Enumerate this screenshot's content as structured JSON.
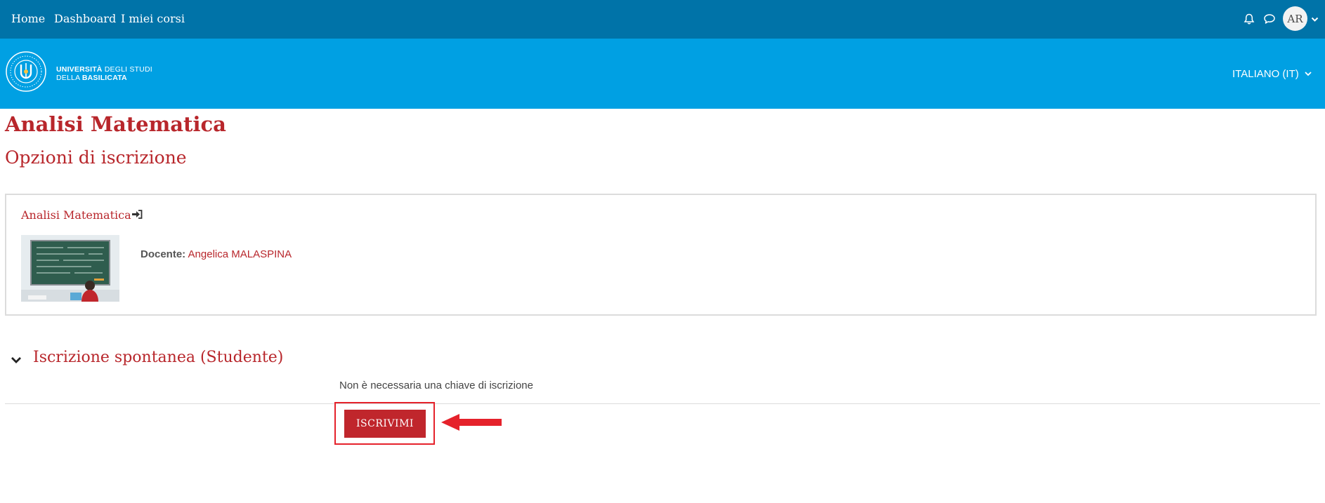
{
  "nav": {
    "links": [
      "Home",
      "Dashboard",
      "I miei corsi"
    ],
    "icons": [
      "bell-icon",
      "chat-icon"
    ],
    "avatar_initials": "AR"
  },
  "banner": {
    "logo_text_line1_bold": "UNIVERSITÀ",
    "logo_text_line1_rest": " DEGLI STUDI",
    "logo_text_line2_rest": "DELLA ",
    "logo_text_line2_bold": "BASILICATA",
    "language": "ITALIANO (IT)"
  },
  "page": {
    "course_title": "Analisi Matematica",
    "subtitle": "Opzioni di iscrizione"
  },
  "course_box": {
    "course_link": "Analisi Matematica",
    "teacher_label": "Docente:",
    "teacher_name": "Angelica MALASPINA"
  },
  "enrolment": {
    "section_title": "Iscrizione spontanea (Studente)",
    "note": "Non è necessaria una chiave di iscrizione",
    "button_label": "ISCRIVIMI"
  },
  "colors": {
    "topbar": "#0073a8",
    "banner": "#00a0e3",
    "accent": "#b8262b",
    "button": "#c0262c",
    "annotation": "#e5222b"
  }
}
